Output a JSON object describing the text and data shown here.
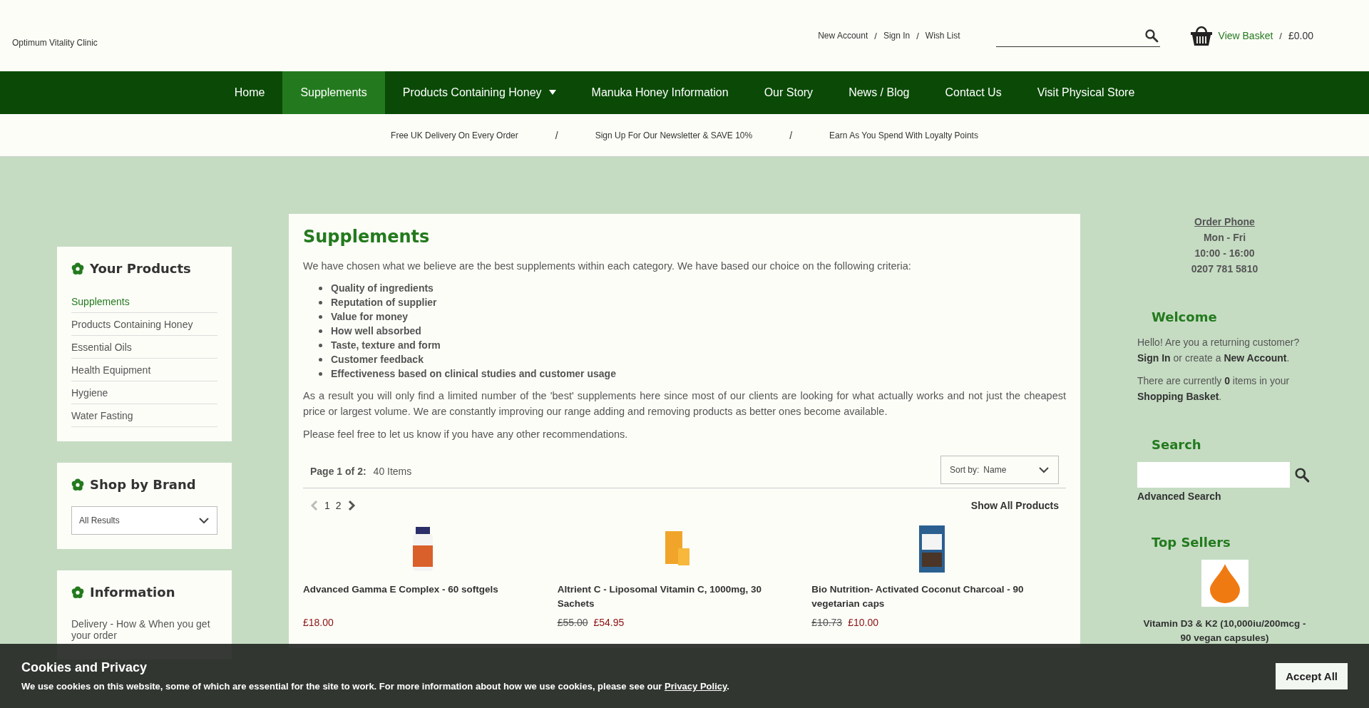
{
  "header": {
    "site_name": "Optimum Vitality Clinic",
    "account_links": [
      "New Account",
      "Sign In",
      "Wish List"
    ],
    "separator": "/",
    "basket": {
      "label": "View Basket",
      "total": "£0.00"
    }
  },
  "nav": [
    {
      "label": "Home",
      "selected": false,
      "has_dropdown": false
    },
    {
      "label": "Supplements",
      "selected": true,
      "has_dropdown": false
    },
    {
      "label": "Products Containing Honey",
      "selected": false,
      "has_dropdown": true
    },
    {
      "label": "Manuka Honey Information",
      "selected": false,
      "has_dropdown": false
    },
    {
      "label": "Our Story",
      "selected": false,
      "has_dropdown": false
    },
    {
      "label": "News / Blog",
      "selected": false,
      "has_dropdown": false
    },
    {
      "label": "Contact Us",
      "selected": false,
      "has_dropdown": false
    },
    {
      "label": "Visit Physical Store",
      "selected": false,
      "has_dropdown": false
    }
  ],
  "promos": {
    "separator": "/",
    "items": [
      "Free UK Delivery On Every Order",
      "Sign Up For Our Newsletter & SAVE 10%",
      "Earn As You Spend With Loyalty Points"
    ]
  },
  "sidebar": {
    "your_products": {
      "title": "Your Products",
      "items": [
        {
          "label": "Supplements",
          "selected": true
        },
        {
          "label": "Products Containing Honey",
          "selected": false
        },
        {
          "label": "Essential Oils",
          "selected": false
        },
        {
          "label": "Health Equipment",
          "selected": false
        },
        {
          "label": "Hygiene",
          "selected": false
        },
        {
          "label": "Water Fasting",
          "selected": false
        }
      ]
    },
    "shop_by_brand": {
      "title": "Shop by Brand",
      "value": "All Results"
    },
    "information": {
      "title": "Information",
      "items": [
        "Delivery - How & When you get your order"
      ]
    }
  },
  "main": {
    "title": "Supplements",
    "intro": "We have chosen what we believe are the best supplements within each category. We have based our choice on the following criteria:",
    "criteria": [
      "Quality of ingredients",
      "Reputation of supplier",
      "Value for money",
      "How well absorbed",
      "Taste, texture and form",
      "Customer feedback",
      "Effectiveness based on clinical studies and customer usage"
    ],
    "paragraphs": [
      "As a result you will only find a limited number of the 'best' supplements here since most of our clients are looking for what actually works and not just the cheapest price or largest volume. We are constantly improving our range adding and removing products as better ones become available.",
      "Please feel free to let us know if you have any other recommendations."
    ],
    "listing": {
      "page_label": "Page 1 of 2:",
      "count": "40 Items",
      "sort": {
        "label": "Sort by:",
        "value": "Name"
      },
      "pager": {
        "prev_disabled": true,
        "next_disabled": false,
        "pages": [
          "1",
          "2"
        ]
      },
      "show_all": "Show All Products",
      "products": [
        {
          "name": "Advanced Gamma E Complex - 60 softgels",
          "price": "£18.00",
          "kind": "bottle"
        },
        {
          "name": "Altrient C - Liposomal Vitamin C, 1000mg, 30 Sachets",
          "old_price": "£55.00",
          "price": "£54.95",
          "kind": "box"
        },
        {
          "name": "Bio Nutrition- Activated Coconut Charcoal - 90 vegetarian caps",
          "old_price": "£10.73",
          "price": "£10.00",
          "kind": "carton"
        }
      ]
    }
  },
  "right": {
    "order_phone": {
      "title": "Order Phone",
      "lines": [
        "Mon - Fri",
        "10:00 - 16:00",
        "0207 781 5810"
      ]
    },
    "welcome": {
      "title": "Welcome",
      "texts": [
        "Hello! Are you a returning customer? **Sign In** or create a **New Account**.",
        "There are currently **0** items in your **Shopping Basket**."
      ]
    },
    "search": {
      "title": "Search",
      "advanced_link": "Advanced Search"
    },
    "top_sellers": {
      "title": "Top Sellers",
      "items": [
        {
          "name": "Vitamin D3 & K2 (10,000iu/200mcg - 90 vegan capsules)"
        }
      ]
    }
  },
  "cookie": {
    "title": "Cookies and Privacy",
    "text": "We use cookies on this website, some of which are essential for the site to work. For more information about how we use cookies, please see our ",
    "link": "Privacy Policy",
    "suffix": ".",
    "button": "Accept All"
  }
}
